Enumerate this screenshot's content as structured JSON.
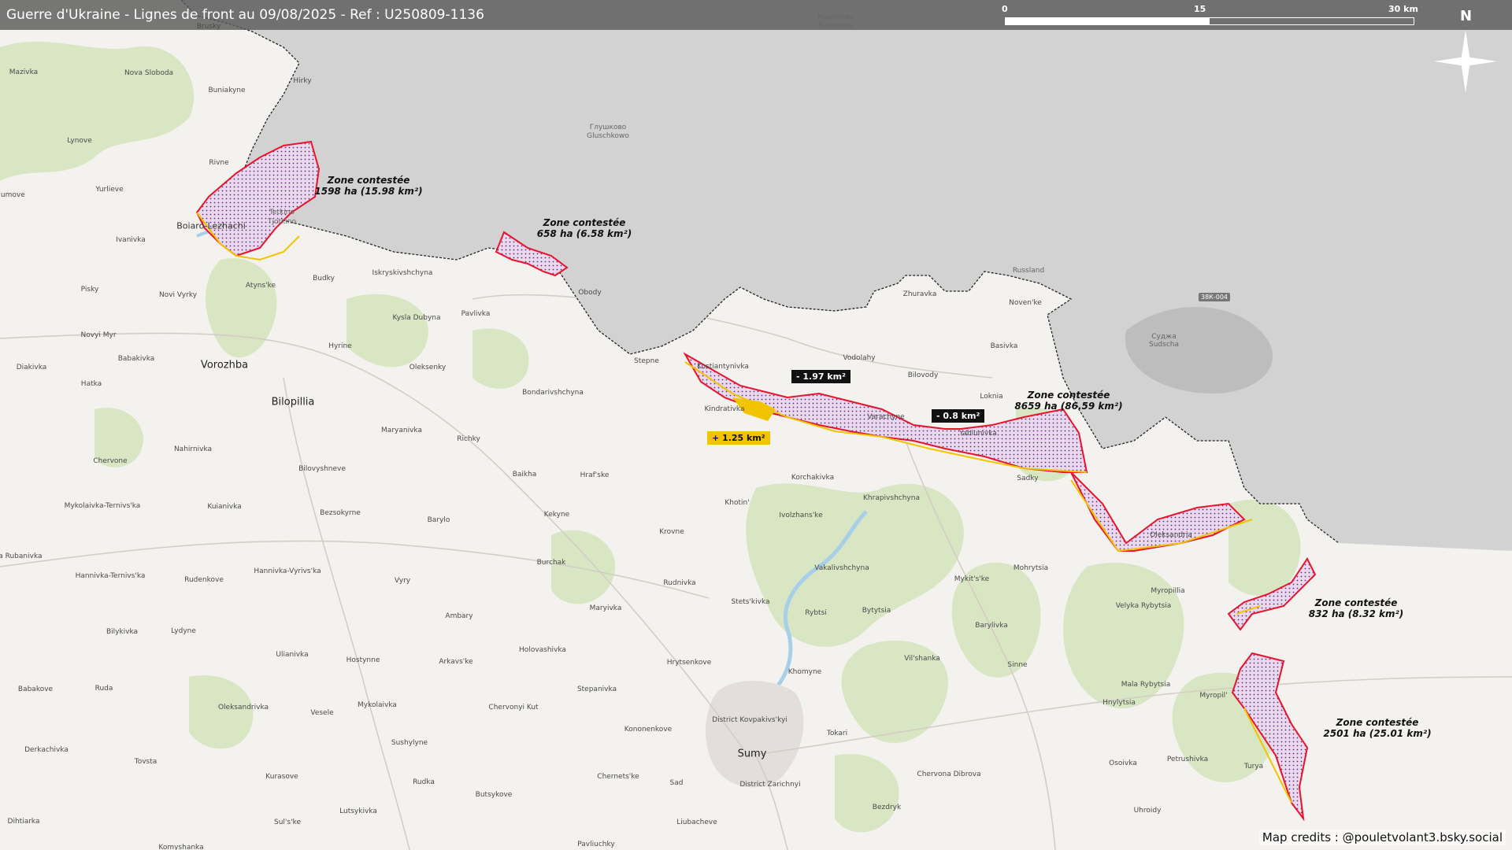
{
  "title": "Guerre d'Ukraine - Lignes de front au 09/08/2025 - Ref : U250809-1136",
  "scale": {
    "ticks": [
      "0",
      "15",
      "30 km"
    ]
  },
  "north_label": "N",
  "credits": "Map credits : @pouletvolant3.bsky.social",
  "road_badge": "38К-004",
  "colors": {
    "contested_outline": "#e8132c",
    "russian_side": "#cdcdcd",
    "ukraine_side": "#f4f2ee",
    "forest": "#d8e6c4",
    "gain": "#f2c400",
    "loss": "#111111",
    "water": "#a8cfe8"
  },
  "zones": [
    {
      "title": "Zone contestée",
      "area": "1598 ha (15.98 km²)"
    },
    {
      "title": "Zone contestée",
      "area": "658 ha (6.58 km²)"
    },
    {
      "title": "Zone contestée",
      "area": "8659 ha (86.59 km²)"
    },
    {
      "title": "Zone contestée",
      "area": "832 ha (8.32 km²)"
    },
    {
      "title": "Zone contestée",
      "area": "2501 ha (25.01 km²)"
    }
  ],
  "changes": [
    {
      "label": "- 1.97 km²",
      "kind": "loss"
    },
    {
      "label": "- 0.8 km²",
      "kind": "loss"
    },
    {
      "label": "+ 1.25 km²",
      "kind": "gain"
    }
  ],
  "places": [
    "Brusky",
    "Mazivka",
    "Nova Sloboda",
    "Buniakyne",
    "Hirky",
    "Lynove",
    "Rivne",
    "Yurlieve",
    "Iumove",
    "Boiaro-Lezhachi",
    "Tetkino",
    "Tjotkino",
    "Ivanivka",
    "Pisky",
    "Novi Vyrky",
    "Atyns'ke",
    "Budky",
    "Iskryskivshchyna",
    "Kysla Dubyna",
    "Pavlivka",
    "Obody",
    "Hyrine",
    "Novyi Myr",
    "Babakivka",
    "Vorozhba",
    "Oleksenky",
    "Stepne",
    "Kostiantynivka",
    "Diakivka",
    "Hatka",
    "Bilopillia",
    "Bondarivshchyna",
    "Maryanivka",
    "Richky",
    "Kindrativka",
    "Nahirnivka",
    "Chervone",
    "Bilovyshneve",
    "Baikha",
    "Hraf'ske",
    "Korchakivka",
    "Khrapivshchyna",
    "Khotin'",
    "Kuianivka",
    "Mykolaivka-Ternivs'ka",
    "Bezsokyrne",
    "Kekyne",
    "Barylo",
    "Ivolzhans'ke",
    "Krovne",
    "Burchak",
    "Mala Rubanivka",
    "Hannivka-Ternivs'ka",
    "Rudenkove",
    "Hannivka-Vyrivs'ka",
    "Vyry",
    "Rudnivka",
    "Ambary",
    "Stets'kivka",
    "Maryivka",
    "Bilykivka",
    "Lydyne",
    "Ulianivka",
    "Hostynne",
    "Arkavs'ke",
    "Holovashivka",
    "Hrytsenkove",
    "Babakove",
    "Ruda",
    "Stepanivka",
    "Oleksandrivka",
    "Vesele",
    "Mykolaivka",
    "Chervonyi Kut",
    "Sushylyne",
    "Kononenkove",
    "Derkachivka",
    "Tovsta",
    "Kurasove",
    "Rudka",
    "Chernets'ke",
    "Butsykove",
    "Sad",
    "Lutsykivka",
    "Sul's'ke",
    "Dihtiarka",
    "Liubacheve",
    "Pavliuchky",
    "Komyshanka",
    "Sumy",
    "Tokari",
    "Khomyne",
    "Rybtsi",
    "Bytytsia",
    "Vakalivshchyna",
    "Mykit's'ke",
    "Mohrytsia",
    "Barylivka",
    "Vil'shanka",
    "Sinne",
    "Velyka Rybytsia",
    "Myropillia",
    "Hnylytsia",
    "Mala Rybytsia",
    "Myropil'",
    "Osoivka",
    "Petrushivka",
    "Turya",
    "Chervona Dibrova",
    "Bezdryk",
    "Uhroidy",
    "Zhuravka",
    "Vodolahy",
    "Bilovody",
    "Loknia",
    "Basivka",
    "Noven'ke",
    "Varachyne",
    "Yablunivka",
    "Sadky",
    "Oleksandria",
    "Глушково",
    "Gluschkowo",
    "Кореневo",
    "Korenewo",
    "Суджа",
    "Sudscha",
    "Russland",
    "District Kovpakivs'kyi",
    "District Zarichnyi"
  ]
}
